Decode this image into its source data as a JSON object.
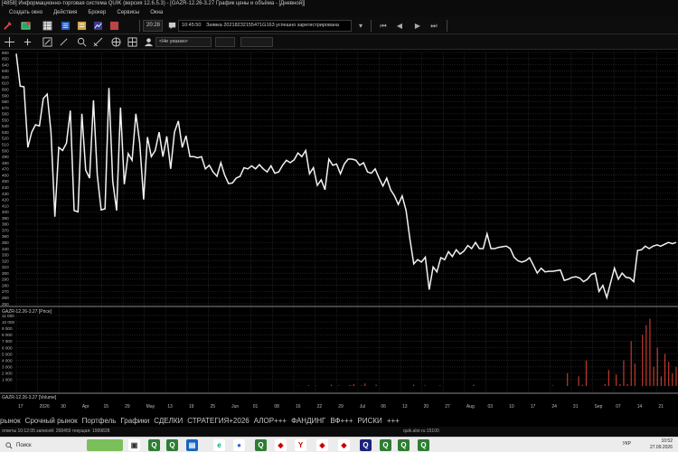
{
  "window": {
    "title": "[4858] Информационно-торговая система QUIK (версия 12.6.5.3) - [GAZR-12.26-3.27 График цены и объёма - [Дневной]]"
  },
  "menu": [
    "Создать окно",
    "Действия",
    "Брокер",
    "Сервисы",
    "Окна"
  ],
  "toolbar": {
    "time_label": "20:28",
    "message_time": "10:45:50",
    "message_text": "Заявка 20218232155471G163 успешно зарегистрирована",
    "mode_combo": "<Не указан>"
  },
  "chart_data": [
    {
      "type": "line",
      "title": "GAZR-12.26-3.27 [Price]",
      "ylim": [
        250,
        660
      ],
      "ytick_labels": [
        660,
        650,
        640,
        630,
        620,
        610,
        600,
        590,
        580,
        570,
        560,
        550,
        540,
        530,
        520,
        510,
        500,
        490,
        480,
        470,
        460,
        450,
        440,
        430,
        420,
        410,
        400,
        390,
        380,
        370,
        360,
        350,
        340,
        330,
        320,
        310,
        300,
        290,
        280,
        270,
        260,
        250
      ],
      "series": [
        {
          "values": [
            658,
            605,
            604,
            505,
            530,
            542,
            540,
            585,
            592,
            530,
            392,
            505,
            500,
            512,
            565,
            402,
            400,
            560,
            468,
            455,
            582,
            460,
            403,
            405,
            602,
            450,
            402,
            570,
            445,
            495,
            484,
            560,
            512,
            420,
            522,
            490,
            500,
            530,
            490,
            523,
            470,
            530,
            548,
            505,
            524,
            490,
            490,
            488,
            490,
            470,
            476,
            465,
            458,
            480,
            460,
            446,
            447,
            455,
            458,
            472,
            470,
            475,
            470,
            477,
            470,
            465,
            475,
            463,
            465,
            476,
            484,
            480,
            485,
            496,
            490,
            500,
            462,
            472,
            443,
            452,
            436,
            486,
            476,
            478,
            462,
            478,
            486,
            486,
            484,
            476,
            480,
            465,
            463,
            470,
            455,
            442,
            455,
            436,
            426,
            412,
            426,
            402,
            356,
            315,
            322,
            318,
            326,
            273,
            310,
            302,
            325,
            322,
            335,
            327,
            338,
            331,
            336,
            345,
            340,
            350,
            340,
            340,
            364,
            340,
            340,
            342,
            343,
            344,
            340,
            326,
            320,
            318,
            320,
            325,
            313,
            300,
            308,
            302,
            303,
            303,
            304,
            305,
            288,
            290,
            293,
            294,
            292,
            286,
            290,
            298,
            300,
            270,
            280,
            260,
            284,
            308,
            290,
            300,
            293,
            292,
            286,
            337,
            338,
            344,
            340,
            344,
            346,
            344,
            347,
            350,
            348,
            350
          ]
        }
      ]
    },
    {
      "type": "bar",
      "title": "GAZR-12.26-3.27 [Volume]",
      "ylim": [
        0,
        11000
      ],
      "ytick_labels": [
        "11 000",
        "10 000",
        "9 000",
        "8 000",
        "7 000",
        "6 000",
        "5 000",
        "4 000",
        "3 000",
        "2 000",
        "1 000"
      ],
      "series": [
        {
          "values": [
            0,
            0,
            0,
            0,
            0,
            0,
            0,
            0,
            0,
            0,
            0,
            0,
            0,
            0,
            0,
            0,
            0,
            0,
            0,
            0,
            0,
            0,
            0,
            0,
            0,
            0,
            0,
            0,
            0,
            0,
            0,
            0,
            0,
            0,
            0,
            0,
            0,
            0,
            0,
            0,
            0,
            0,
            0,
            0,
            0,
            0,
            0,
            0,
            0,
            0,
            0,
            0,
            0,
            0,
            0,
            0,
            0,
            0,
            0,
            0,
            0,
            0,
            0,
            0,
            0,
            0,
            0,
            0,
            0,
            0,
            0,
            0,
            0,
            0,
            0,
            50,
            0,
            0,
            120,
            0,
            60,
            0,
            0,
            0,
            200,
            0,
            100,
            0,
            0,
            150,
            300,
            0,
            80,
            400,
            0,
            0,
            200,
            0,
            0,
            0,
            0,
            0,
            0,
            0,
            0,
            0,
            200,
            0,
            0,
            100,
            0,
            0,
            0,
            100,
            0,
            0,
            0,
            0,
            0,
            0,
            0,
            0,
            200,
            0,
            0,
            0,
            0,
            0,
            0,
            0,
            0,
            0,
            0,
            0,
            0,
            0,
            0,
            0,
            0,
            0,
            0,
            0,
            0,
            100,
            0,
            0,
            0,
            2000,
            0,
            0,
            1500,
            200,
            4000,
            0,
            0,
            0,
            0,
            300,
            2500,
            0,
            1800,
            300,
            4000,
            300,
            7000,
            3500,
            0,
            8000,
            9500,
            10500,
            3000,
            6000,
            1500,
            5000,
            3800,
            2000,
            3000
          ]
        }
      ]
    }
  ],
  "dates": {
    "first_row": [
      "17",
      "",
      "30",
      "15",
      "",
      "29",
      "",
      "Maй",
      "",
      "",
      "",
      "19",
      "",
      "",
      "Jun",
      "",
      "",
      "",
      "",
      "Jul",
      "",
      "",
      "",
      "",
      "",
      "Aug",
      "",
      "",
      "",
      "Sep",
      "",
      "",
      ""
    ],
    "second_row": [
      "2026",
      "",
      "Apr",
      "",
      "",
      "May",
      "",
      "",
      "",
      "",
      "",
      "Jun",
      "",
      "",
      "",
      "Jul",
      "",
      "",
      "",
      "",
      "",
      "Aug",
      "",
      "",
      "",
      "",
      "",
      "Sep",
      "",
      "",
      ""
    ],
    "labels": [
      "17",
      "2026",
      "30",
      "Apr",
      "15",
      "29",
      "May",
      "13",
      "19",
      "25",
      "Jun",
      "01",
      "08",
      "16",
      "22",
      "29",
      "Jul",
      "06",
      "13",
      "20",
      "27",
      "Aug",
      "03",
      "10",
      "17",
      "24",
      "31",
      "Sep",
      "07",
      "14",
      "21"
    ]
  },
  "tabs": [
    "рынок",
    "Срочный рынок",
    "Портфель",
    "Графики",
    "СДЕЛКИ",
    "СТРАТЕГИЯ+2026",
    "АЛОР+++",
    "ФАНДИНГ",
    "ВФ+++",
    "РИСКИ",
    "+++"
  ],
  "status": {
    "left": "ответы 10:12:05 записей: 268459  текущая: 1999828",
    "right": "quik.alor.ru:15100"
  },
  "taskbar": {
    "search": "Поиск",
    "lang": "УКР",
    "time": "10:52",
    "date": "27.09.2026",
    "apps": [
      "Q",
      "Q",
      "Q",
      "Y",
      "Q",
      "Q",
      "Q",
      "Q",
      "Q"
    ]
  }
}
